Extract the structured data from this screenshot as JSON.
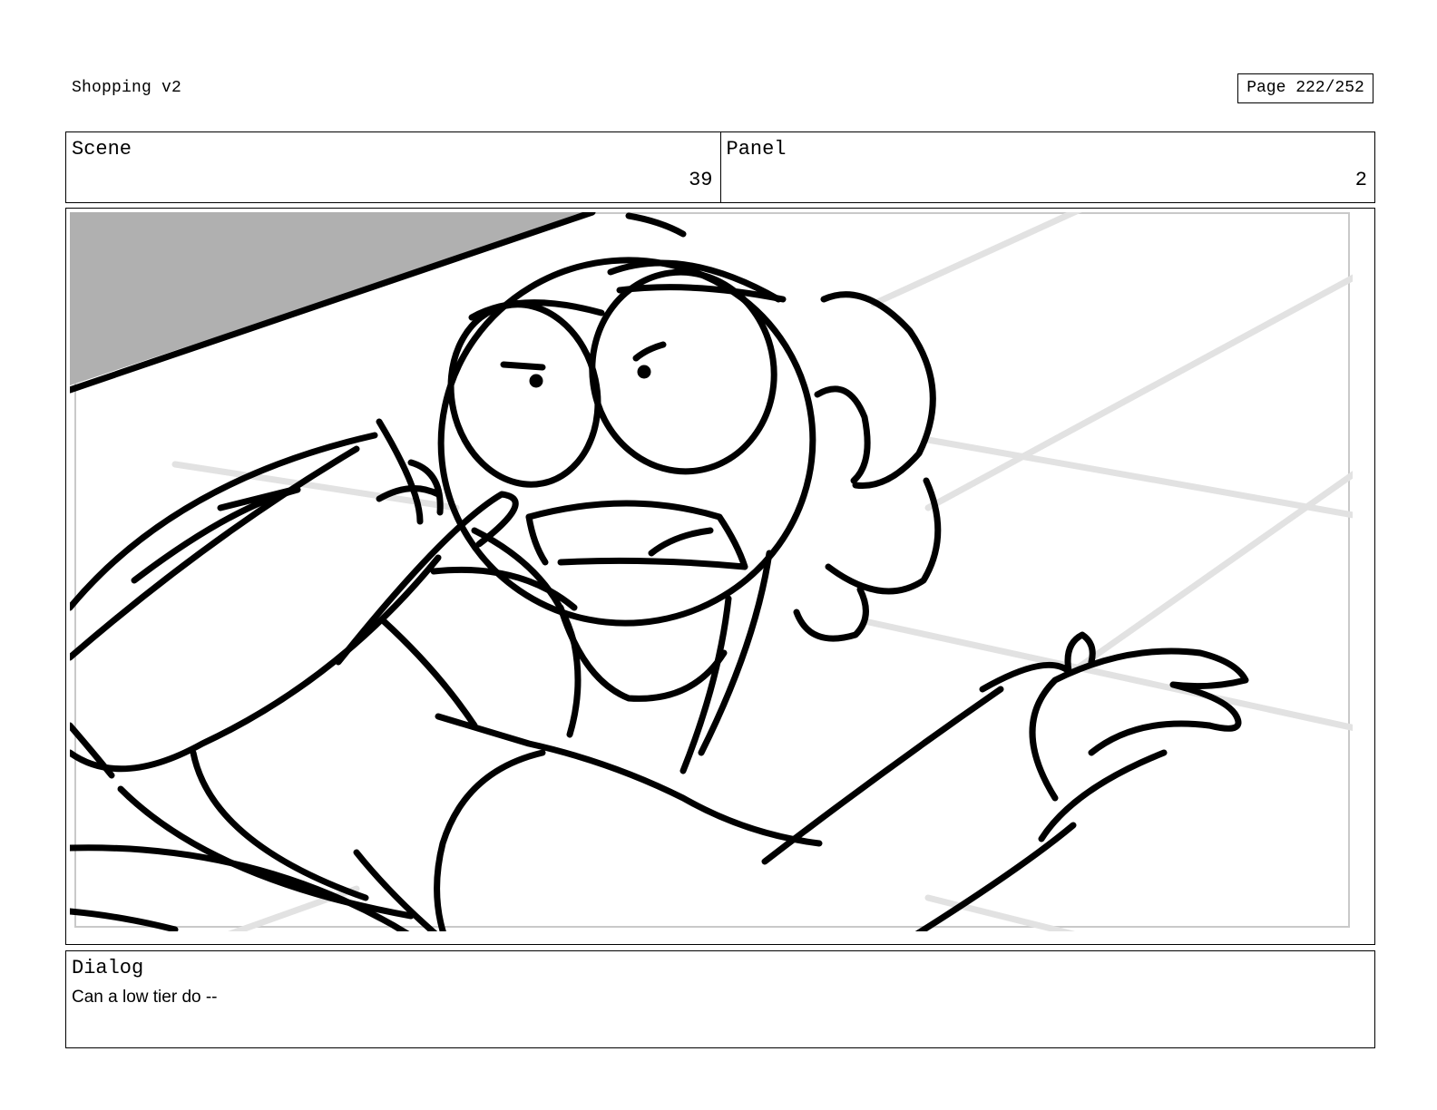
{
  "header": {
    "title": "Shopping v2",
    "page_label": "Page 222/252"
  },
  "info": {
    "scene_label": "Scene",
    "scene_value": "39",
    "panel_label": "Panel",
    "panel_value": "2"
  },
  "dialog": {
    "label": "Dialog",
    "text": "Can a low tier do --"
  },
  "colors": {
    "ink": "#000000",
    "floor_lines": "#e2e2e2",
    "shadow_fill": "#b0b0b0"
  }
}
